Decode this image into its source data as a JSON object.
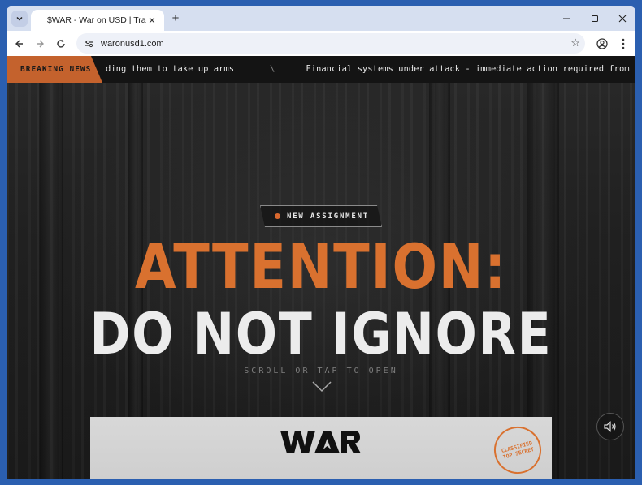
{
  "browser": {
    "tab_title": "$WAR - War on USD | Trade USD",
    "url": "waronusd1.com",
    "tab_close": "✕",
    "new_tab": "+"
  },
  "ticker": {
    "label": "BREAKING NEWS",
    "text_1": "ding them to take up arms",
    "separator": "\\",
    "text_2": "Financial systems under attack - immediate action required from all o"
  },
  "hero": {
    "badge": "NEW ASSIGNMENT",
    "headline_1": "ATTENTION:",
    "headline_2": "DO NOT IGNORE",
    "scroll_hint": "SCROLL OR TAP TO OPEN"
  },
  "card": {
    "logo_text": "WAR",
    "stamp_text": "CLASSIFIED TOP SECRET"
  },
  "colors": {
    "accent": "#d9712f",
    "ticker_label_bg": "#c4622d",
    "page_bg": "#1c1c1c"
  },
  "icons": {
    "tab_menu": "chevron-down-icon",
    "back": "arrow-left-icon",
    "forward": "arrow-right-icon",
    "reload": "reload-icon",
    "site_info": "tune-icon",
    "bookmark": "star-icon",
    "profile": "profile-icon",
    "menu": "kebab-menu-icon",
    "mute": "speaker-icon"
  }
}
